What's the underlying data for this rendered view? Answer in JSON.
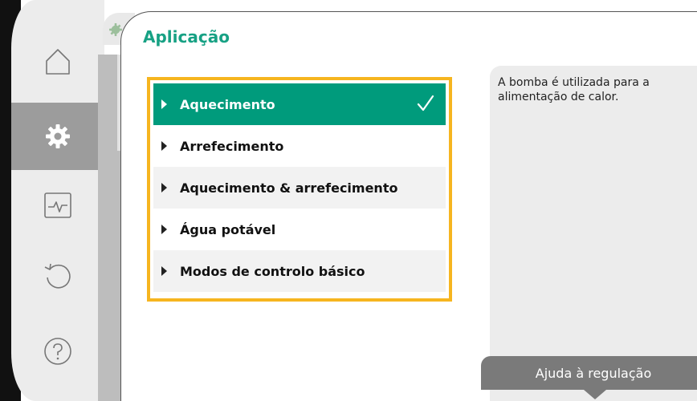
{
  "page": {
    "title": "Aplicação"
  },
  "sidebar": {
    "items": [
      {
        "icon": "home-icon",
        "active": false
      },
      {
        "icon": "gear-icon",
        "active": true
      },
      {
        "icon": "monitor-icon",
        "active": false
      },
      {
        "icon": "undo-icon",
        "active": false
      },
      {
        "icon": "help-icon",
        "active": false
      }
    ]
  },
  "menu": {
    "items": [
      {
        "label": "Aquecimento",
        "selected": true
      },
      {
        "label": "Arrefecimento",
        "selected": false
      },
      {
        "label": "Aquecimento & arrefecimento",
        "selected": false
      },
      {
        "label": "Água potável",
        "selected": false
      },
      {
        "label": "Modos de controlo básico",
        "selected": false
      }
    ]
  },
  "help": {
    "text": "A bomba é utilizada para a alimentação de calor.",
    "button_label": "Ajuda à regulação"
  },
  "colors": {
    "accent": "#009b7c",
    "title": "#17a184",
    "focus_border": "#f6b51f",
    "sidebar_active": "#9c9c9c"
  }
}
